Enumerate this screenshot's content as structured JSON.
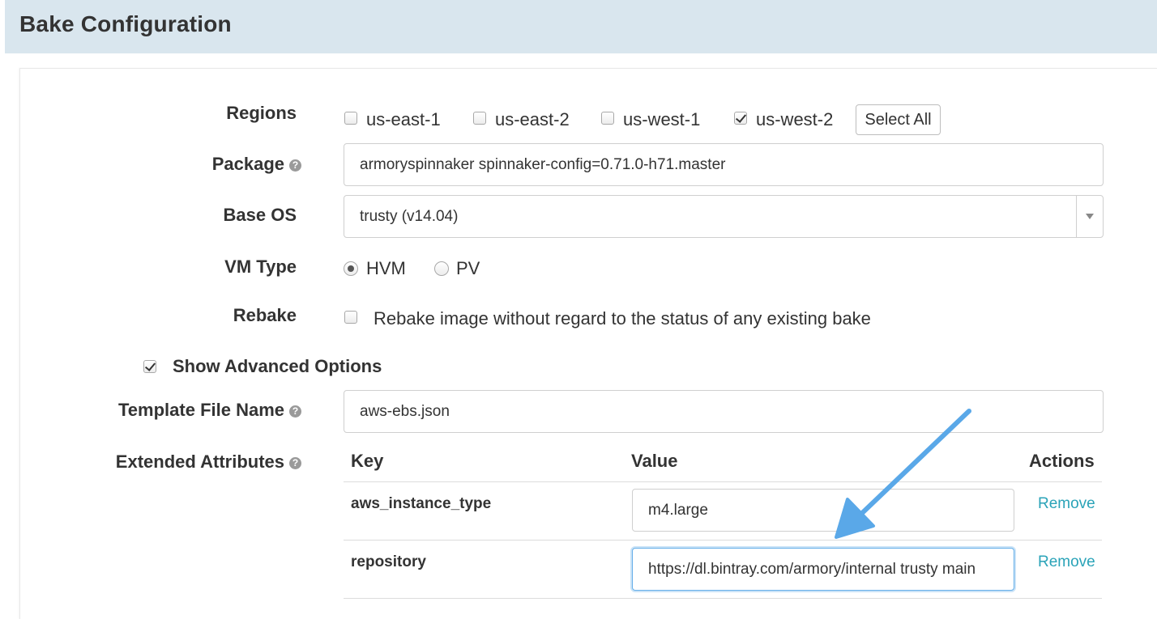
{
  "header": {
    "title": "Bake Configuration"
  },
  "form": {
    "regions": {
      "label": "Regions",
      "options": [
        {
          "label": "us-east-1",
          "checked": false
        },
        {
          "label": "us-east-2",
          "checked": false
        },
        {
          "label": "us-west-1",
          "checked": false
        },
        {
          "label": "us-west-2",
          "checked": true
        }
      ],
      "select_all": "Select All"
    },
    "package": {
      "label": "Package",
      "value": "armoryspinnaker spinnaker-config=0.71.0-h71.master"
    },
    "base_os": {
      "label": "Base OS",
      "value": "trusty (v14.04)"
    },
    "vm_type": {
      "label": "VM Type",
      "options": [
        {
          "label": "HVM",
          "selected": true
        },
        {
          "label": "PV",
          "selected": false
        }
      ]
    },
    "rebake": {
      "label": "Rebake",
      "text": "Rebake image without regard to the status of any existing bake",
      "checked": false
    },
    "advanced": {
      "label": "Show Advanced Options",
      "checked": true
    },
    "template_file": {
      "label": "Template File Name",
      "value": "aws-ebs.json"
    },
    "extended_attributes": {
      "label": "Extended Attributes",
      "headers": {
        "key": "Key",
        "value": "Value",
        "actions": "Actions"
      },
      "rows": [
        {
          "key": "aws_instance_type",
          "value": "m4.large",
          "action": "Remove"
        },
        {
          "key": "repository",
          "value": "https://dl.bintray.com/armory/internal trusty main",
          "action": "Remove"
        }
      ]
    }
  },
  "colors": {
    "header_bg": "#d9e6ee",
    "link": "#2aa3b8",
    "arrow": "#5aa8e8"
  }
}
